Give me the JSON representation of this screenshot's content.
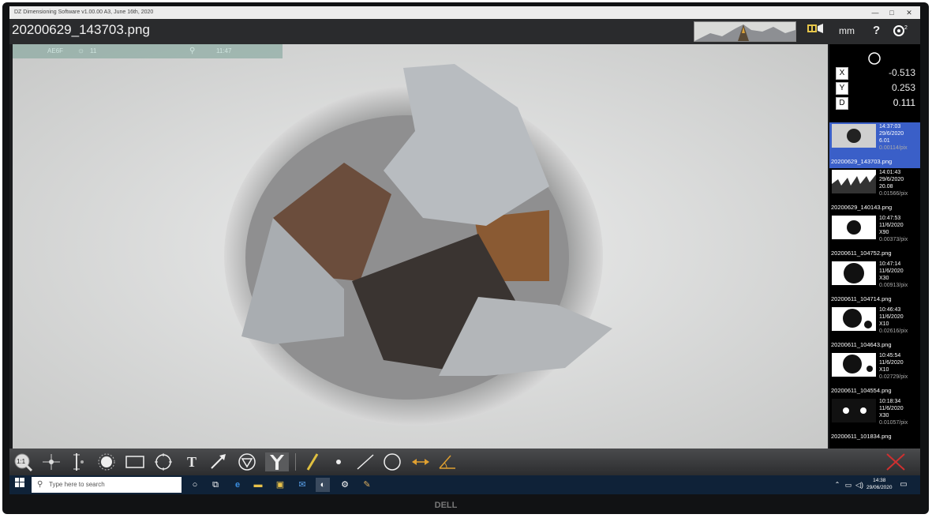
{
  "window": {
    "title": "DZ Dimensioning Software v1.00.00 A3, June 16th, 2020",
    "minimize": "—",
    "maximize": "□",
    "close": "✕"
  },
  "appbar": {
    "filename": "20200629_143703.png",
    "units": "mm",
    "help": "?"
  },
  "overlay": {
    "left_text": "AE6F",
    "mid_text": "11",
    "right_text": "11:47"
  },
  "readout": {
    "x_label": "X",
    "x_value": "-0.513",
    "y_label": "Y",
    "y_value": "0.253",
    "d_label": "D",
    "d_value": "0.111"
  },
  "thumbnails": [
    {
      "time": "14:37:03",
      "date": "29/6/2020",
      "zoom": "6.01",
      "scale": "0.00114/pix",
      "name": "20200629_143703.png",
      "selected": true
    },
    {
      "time": "14:01:43",
      "date": "29/6/2020",
      "zoom": "20.08",
      "scale": "0.01566/pix",
      "name": "20200629_140143.png",
      "selected": false
    },
    {
      "time": "10:47:53",
      "date": "11/6/2020",
      "zoom": "X90",
      "scale": "0.00373/pix",
      "name": "20200611_104752.png",
      "selected": false
    },
    {
      "time": "10:47:14",
      "date": "11/6/2020",
      "zoom": "X30",
      "scale": "0.00913/pix",
      "name": "20200611_104714.png",
      "selected": false
    },
    {
      "time": "10:46:43",
      "date": "11/6/2020",
      "zoom": "X10",
      "scale": "0.02616/pix",
      "name": "20200611_104643.png",
      "selected": false
    },
    {
      "time": "10:45:54",
      "date": "11/6/2020",
      "zoom": "X10",
      "scale": "0.02729/pix",
      "name": "20200611_104554.png",
      "selected": false
    },
    {
      "time": "10:18:34",
      "date": "11/6/2020",
      "zoom": "X30",
      "scale": "0.01057/pix",
      "name": "20200611_101834.png",
      "selected": false
    }
  ],
  "toolbar": {
    "scale_label": "1:1",
    "text_tool": "T"
  },
  "taskbar": {
    "search_placeholder": "Type here to search",
    "time": "14:38",
    "date": "29/06/2020"
  },
  "brand": "DELL"
}
